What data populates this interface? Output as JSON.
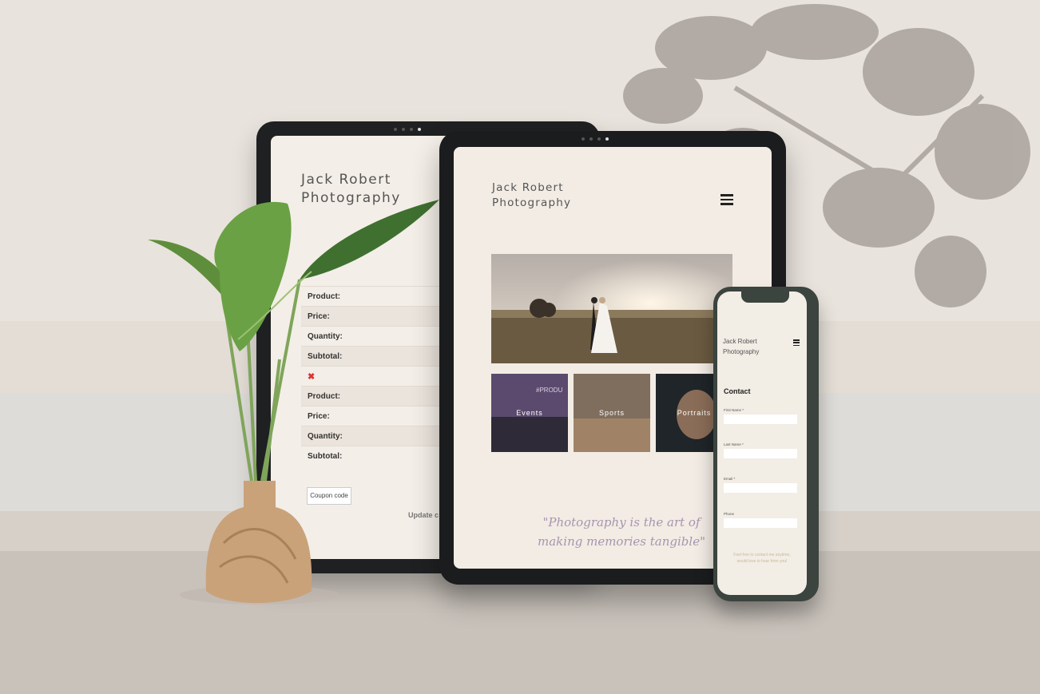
{
  "back_tablet": {
    "site_title_line1": "Jack Robert",
    "site_title_line2": "Photography",
    "cart_rows": [
      {
        "label": "Product:"
      },
      {
        "label": "Price:"
      },
      {
        "label": "Quantity:"
      },
      {
        "label": "Subtotal:"
      },
      {
        "label": "✖"
      },
      {
        "label": "Product:"
      },
      {
        "label": "Price:"
      },
      {
        "label": "Quantity:"
      },
      {
        "label": "Subtotal:"
      }
    ],
    "coupon_placeholder": "Coupon code",
    "update_cart_label": "Update c"
  },
  "front_tablet": {
    "site_title_line1": "Jack Robert",
    "site_title_line2": "Photography",
    "menu_icon": "hamburger-icon",
    "tiles": [
      {
        "label": "Events",
        "overlay_text": "#PRODU"
      },
      {
        "label": "Sports"
      },
      {
        "label": "Portraits"
      }
    ],
    "quote_line1": "\"Photography is the art of",
    "quote_line2": "making memories tangible\""
  },
  "phone": {
    "site_title_line1": "Jack Robert",
    "site_title_line2": "Photography",
    "menu_icon": "hamburger-icon",
    "contact_heading": "Contact",
    "fields": [
      {
        "label": "First Name *"
      },
      {
        "label": "Last Name *"
      },
      {
        "label": "Email *"
      },
      {
        "label": "Phone"
      }
    ],
    "footer_line1": "Feel free to contact me anytime,",
    "footer_line2": "would love to hear from you!"
  },
  "colors": {
    "screen_bg": "#f2ece4",
    "quote_color": "#a795b0",
    "remove_color": "#dd3333"
  }
}
